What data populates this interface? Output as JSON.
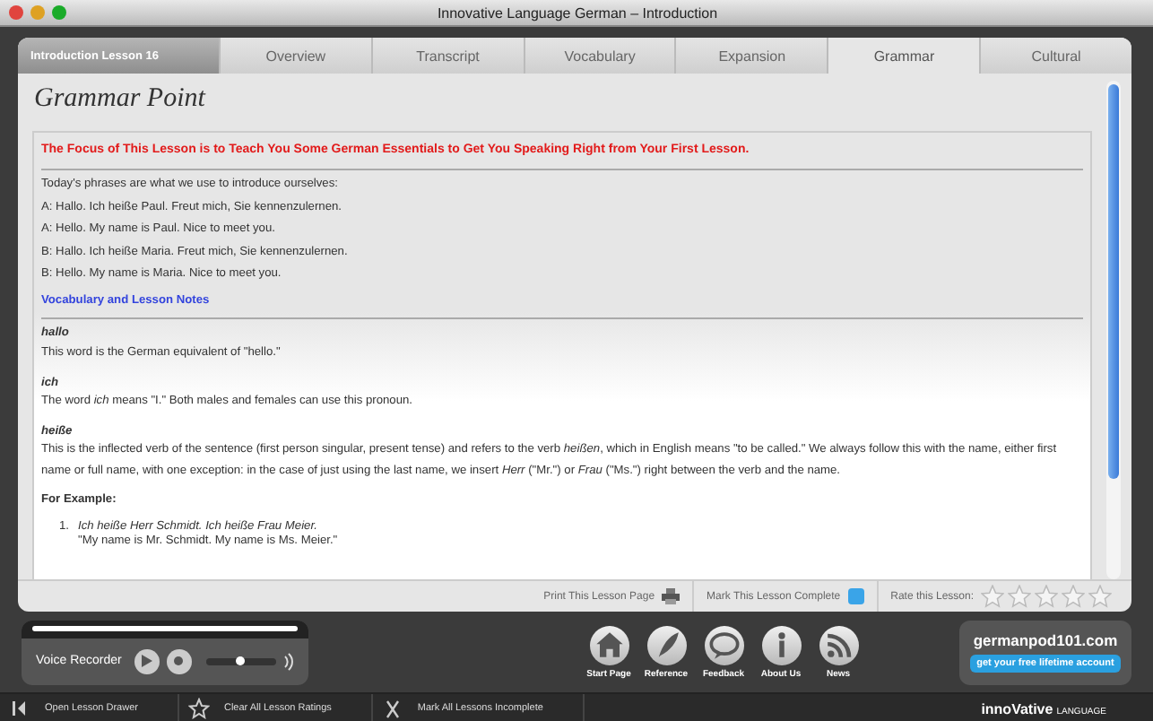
{
  "window": {
    "title": "Innovative Language German – Introduction"
  },
  "lesson_label": "Introduction Lesson 16",
  "tabs": [
    {
      "label": "Overview",
      "selected": false
    },
    {
      "label": "Transcript",
      "selected": false
    },
    {
      "label": "Vocabulary",
      "selected": false
    },
    {
      "label": "Expansion",
      "selected": false
    },
    {
      "label": "Grammar",
      "selected": true
    },
    {
      "label": "Cultural",
      "selected": false
    }
  ],
  "heading": "Grammar Point",
  "content": [
    {
      "kind": "focus",
      "text": "The Focus of This Lesson is to Teach You Some German Essentials to Get You Speaking Right from Your First Lesson."
    },
    {
      "kind": "rule"
    },
    {
      "kind": "para",
      "text": "Today's phrases are what we use to introduce ourselves:"
    },
    {
      "kind": "para",
      "text": "A: Hallo. Ich heiße Paul. Freut mich, Sie kennenzulernen."
    },
    {
      "kind": "para",
      "text": "A: Hello. My name is Paul. Nice to meet you."
    },
    {
      "kind": "para",
      "text": "B: Hallo. Ich heiße Maria. Freut mich, Sie kennenzulernen."
    },
    {
      "kind": "para",
      "text": "B: Hello. My name is Maria. Nice to meet you."
    },
    {
      "kind": "section",
      "text": "Vocabulary and Lesson Notes"
    },
    {
      "kind": "rule"
    },
    {
      "kind": "term",
      "term": "hallo",
      "text": "This word is the German equivalent of \"hello.\""
    },
    {
      "kind": "term",
      "term": "ich",
      "text": "The word *ich* means \"I.\" Both males and females can use this pronoun."
    },
    {
      "kind": "term",
      "term": "heiße",
      "text": "This is the inflected verb of the sentence (first person singular, present tense) and refers to the verb *heißen*, which in English means \"to be called.\" We always follow this with the name, either first name or full name, with one exception: in the case of just using the last name, we insert *Herr* (\"Mr.\") or *Frau* (\"Ms.\") right between the verb and the name."
    },
    {
      "kind": "subhead",
      "text": "For Example:"
    },
    {
      "kind": "example",
      "number": "1.",
      "text": "Ich heiße Herr Schmidt. Ich heiße Frau Meier.",
      "translation": "\"My name is Mr. Schmidt. My name is Ms. Meier.\""
    }
  ],
  "actions": {
    "print": "Print This Lesson Page",
    "complete": "Mark This Lesson Complete",
    "rate": "Rate this Lesson:",
    "stars": 0
  },
  "recorder": {
    "label": "Voice Recorder",
    "level": 0.5
  },
  "nav": [
    {
      "kind": "home",
      "label": "Start Page"
    },
    {
      "kind": "quill",
      "label": "Reference"
    },
    {
      "kind": "bubble",
      "label": "Feedback"
    },
    {
      "kind": "info",
      "label": "About Us"
    },
    {
      "kind": "rss",
      "label": "News"
    }
  ],
  "promo": {
    "site": "germanpod101.com",
    "button": "get your free lifetime account"
  },
  "footer": [
    {
      "kind": "drawer",
      "label": "Open Lesson Drawer"
    },
    {
      "kind": "star",
      "label": "Clear All Lesson Ratings"
    },
    {
      "kind": "cross",
      "label": "Mark All Lessons Incomplete"
    }
  ],
  "brand": {
    "name": "innoVative",
    "suffix": "LANGUAGE"
  }
}
